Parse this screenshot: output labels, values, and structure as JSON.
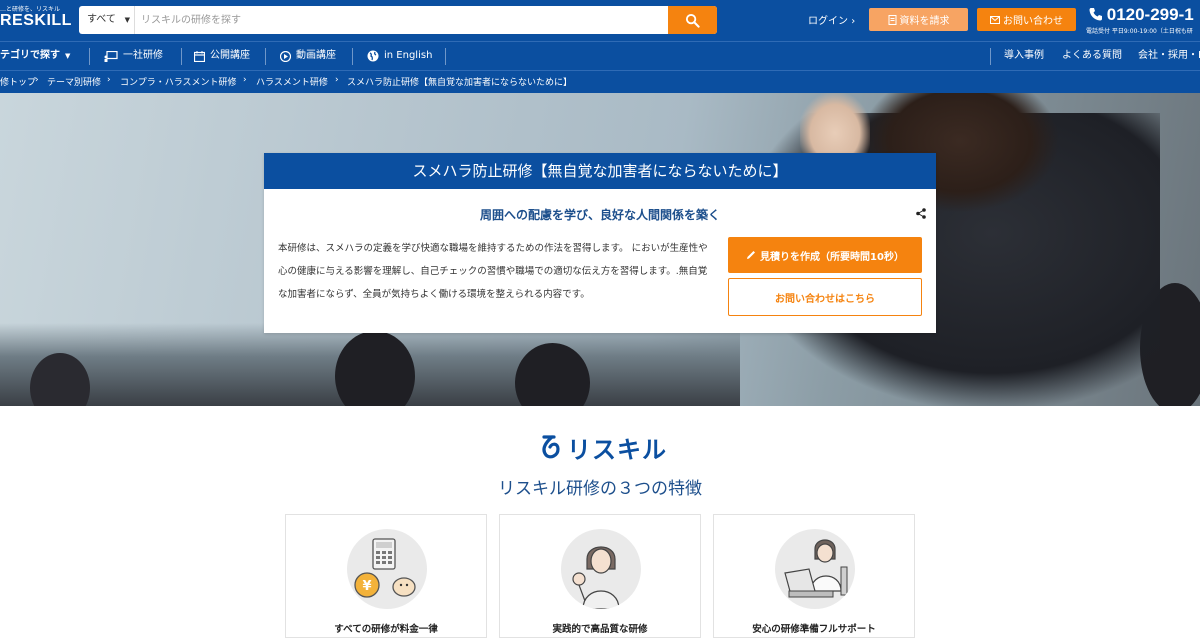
{
  "header": {
    "logo_tagline": "…と研修を、リスキル",
    "logo_text": "RESKILL",
    "search": {
      "category": "すべて",
      "placeholder": "リスキルの研修を探す"
    },
    "login_label": "ログイン",
    "doc_request_label": "資料を請求",
    "contact_label": "お問い合わせ",
    "phone": "0120-299-1",
    "phone_hours": "電話受付 平日9:00-19:00（土日祝も研"
  },
  "nav": {
    "items": [
      {
        "label": "テゴリで探す"
      },
      {
        "label": "一社研修"
      },
      {
        "label": "公開講座"
      },
      {
        "label": "動画講座"
      },
      {
        "label": "in English"
      }
    ],
    "right_items": [
      {
        "label": "導入事例"
      },
      {
        "label": "よくある質問"
      },
      {
        "label": "会社・採用・IF"
      }
    ]
  },
  "breadcrumb": [
    "修トップ",
    "テーマ別研修",
    "コンプラ・ハラスメント研修",
    "ハラスメント研修",
    "スメハラ防止研修【無自覚な加害者にならないために】"
  ],
  "course": {
    "title": "スメハラ防止研修【無自覚な加害者にならないために】",
    "subtitle": "周囲への配慮を学び、良好な人間関係を築く",
    "description": "本研修は、スメハラの定義を学び快適な職場を維持するための作法を習得します。 においが生産性や心の健康に与える影響を理解し、自己チェックの習慣や職場での適切な伝え方を習得します。.無自覚な加害者にならず、全員が気持ちよく働ける環境を整えられる内容です。",
    "estimate_button": "見積りを作成（所要時間10秒）",
    "contact_button": "お問い合わせはこちら"
  },
  "brand_section": {
    "brand_name": "リスキル",
    "title": "リスキル研修の３つの特徴",
    "features": [
      {
        "label": "すべての研修が料金一律",
        "icon": "calculator-coin-icon"
      },
      {
        "label": "実践的で高品質な研修",
        "icon": "instructor-ok-icon"
      },
      {
        "label": "安心の研修準備フルサポート",
        "icon": "support-laptop-icon"
      }
    ]
  },
  "colors": {
    "primary": "#0b4fa0",
    "accent": "#f5830f",
    "accent_light": "#f7a463"
  }
}
